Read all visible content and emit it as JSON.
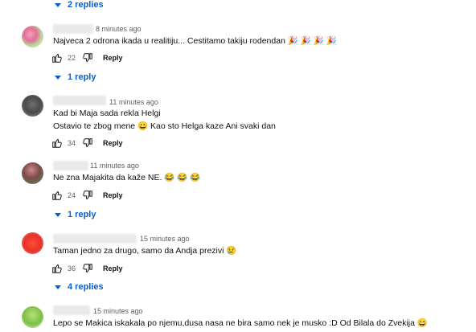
{
  "top_replies": {
    "label": "2 replies"
  },
  "comments": [
    {
      "time": "8 minutes ago",
      "lines": [
        "Najveca 2 odrona ikada u realitiju... Cestitamo takiju rodendan 🎉 🎉 🎉 🎉"
      ],
      "likes": "22",
      "reply_label": "Reply",
      "replies_label": "1 reply"
    },
    {
      "time": "11 minutes ago",
      "lines": [
        "Kad bi Maja sada rekla Helgi",
        "Ostavio te zbog mene 😀  Kao sto Helga kaze Ani svaki dan"
      ],
      "likes": "34",
      "reply_label": "Reply",
      "replies_label": ""
    },
    {
      "time": "11 minutes ago",
      "lines": [
        "Ne zna Majakita da kaže NE. 😂 😂 😂"
      ],
      "likes": "24",
      "reply_label": "Reply",
      "replies_label": "1 reply"
    },
    {
      "time": "15 minutes ago",
      "lines": [
        "Taman jedno za drugo, samo da Andja prezivi 😢"
      ],
      "likes": "36",
      "reply_label": "Reply",
      "replies_label": "4 replies"
    },
    {
      "time": "15 minutes ago",
      "lines": [
        "Lepo se Makica iskakala po njemu,dusa nasa ne bira samo nek je musko :D Od Bilala do Zvekija 😄"
      ],
      "likes": "",
      "reply_label": "",
      "replies_label": ""
    }
  ],
  "colors": {
    "link": "#065fd4",
    "meta": "#606060",
    "text": "#0f0f0f"
  },
  "icons": [
    "like-icon",
    "dislike-icon",
    "chevron-down-icon"
  ]
}
